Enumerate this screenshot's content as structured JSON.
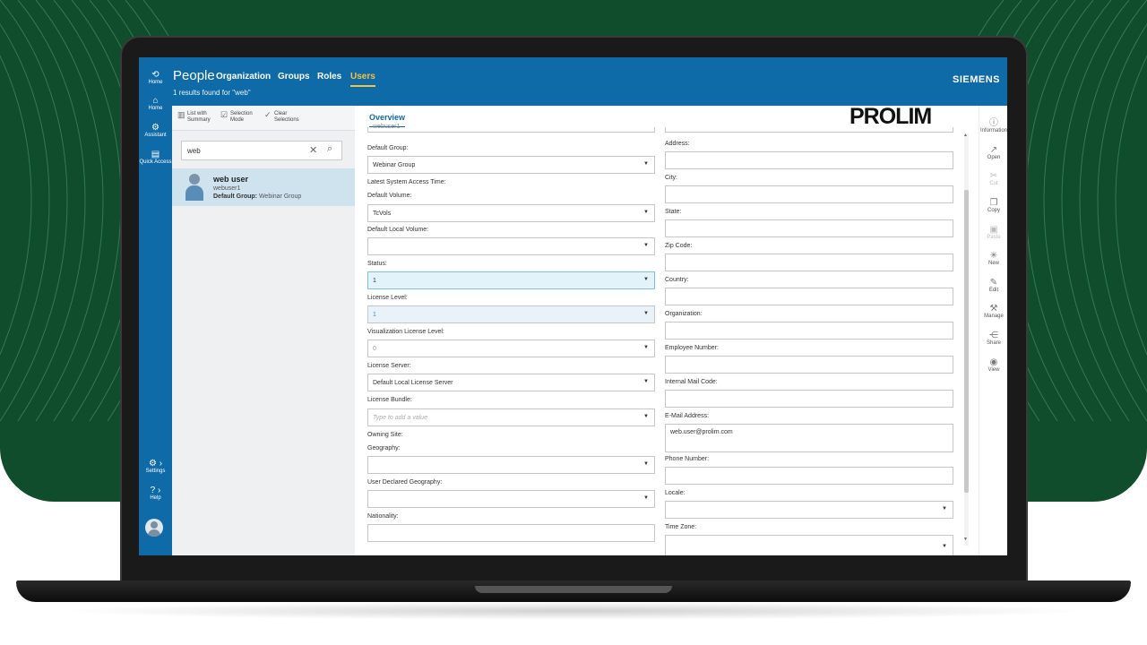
{
  "app": {
    "title": "People",
    "results": "1 results found for \"web\"",
    "brand": "SIEMENS",
    "logo": "PROLIM"
  },
  "nav_tabs": [
    "Organization",
    "Groups",
    "Roles",
    "Users"
  ],
  "active_tab": "Users",
  "left_rail": [
    {
      "label": "Home",
      "icon": "back-home-icon"
    },
    {
      "label": "Home",
      "icon": "home-icon"
    },
    {
      "label": "Assistant",
      "icon": "assistant-icon"
    },
    {
      "label": "Quick Access",
      "icon": "quick-access-icon"
    },
    {
      "label": "Settings",
      "icon": "gear-icon"
    },
    {
      "label": "Help",
      "icon": "help-icon"
    }
  ],
  "list_toolbar": [
    {
      "label": "List with Summary",
      "icon": "list-summary-icon"
    },
    {
      "label": "Selection Mode",
      "icon": "selection-mode-icon"
    },
    {
      "label": "Clear Selections",
      "icon": "clear-selection-icon"
    }
  ],
  "search": {
    "value": "web",
    "placeholder": ""
  },
  "user": {
    "name": "web user",
    "id": "webuser1",
    "group_label": "Default Group:",
    "group_value": "Webinar Group"
  },
  "overview_tab": "Overview",
  "left_fields": {
    "top_value": "webuser1",
    "default_group": {
      "label": "Default Group:",
      "value": "Webinar Group"
    },
    "latest_access": {
      "label": "Latest System Access Time:"
    },
    "default_volume": {
      "label": "Default Volume:",
      "value": "TcVols"
    },
    "default_local_volume": {
      "label": "Default Local Volume:",
      "value": ""
    },
    "status": {
      "label": "Status:",
      "value": "1"
    },
    "license_level": {
      "label": "License Level:",
      "value": "1"
    },
    "vis_license_level": {
      "label": "Visualization License Level:",
      "value": "0"
    },
    "license_server": {
      "label": "License Server:",
      "value": "Default Local License Server"
    },
    "license_bundle": {
      "label": "License Bundle:",
      "placeholder": "Type to add a value"
    },
    "owning_site": {
      "label": "Owning Site:"
    },
    "geography": {
      "label": "Geography:",
      "value": ""
    },
    "user_declared_geography": {
      "label": "User Declared Geography:",
      "value": ""
    },
    "nationality": {
      "label": "Nationality:",
      "value": ""
    }
  },
  "right_fields": {
    "address": {
      "label": "Address:",
      "value": ""
    },
    "city": {
      "label": "City:",
      "value": ""
    },
    "state": {
      "label": "State:",
      "value": ""
    },
    "zip": {
      "label": "Zip Code:",
      "value": ""
    },
    "country": {
      "label": "Country:",
      "value": ""
    },
    "organization": {
      "label": "Organization:",
      "value": ""
    },
    "employee_number": {
      "label": "Employee Number:",
      "value": ""
    },
    "internal_mail_code": {
      "label": "Internal Mail Code:",
      "value": ""
    },
    "email": {
      "label": "E-Mail Address:",
      "value": "web.user@prolim.com"
    },
    "phone": {
      "label": "Phone Number:",
      "value": ""
    },
    "locale": {
      "label": "Locale:",
      "value": ""
    },
    "time_zone": {
      "label": "Time Zone:",
      "value": ""
    }
  },
  "right_rail": [
    {
      "label": "Information",
      "icon": "info-icon",
      "enabled": true
    },
    {
      "label": "Open",
      "icon": "open-icon",
      "enabled": true
    },
    {
      "label": "Cut",
      "icon": "cut-icon",
      "enabled": false
    },
    {
      "label": "Copy",
      "icon": "copy-icon",
      "enabled": true
    },
    {
      "label": "Paste",
      "icon": "paste-icon",
      "enabled": false
    },
    {
      "label": "New",
      "icon": "new-icon",
      "enabled": true
    },
    {
      "label": "Edit",
      "icon": "edit-icon",
      "enabled": true
    },
    {
      "label": "Manage",
      "icon": "manage-icon",
      "enabled": true
    },
    {
      "label": "Share",
      "icon": "share-icon",
      "enabled": true
    },
    {
      "label": "View",
      "icon": "view-icon",
      "enabled": true
    }
  ],
  "colors": {
    "header": "#0f6aa8",
    "accent": "#f5c242",
    "background_green": "#0f4d2c",
    "selected_row": "#cfe3ef"
  }
}
